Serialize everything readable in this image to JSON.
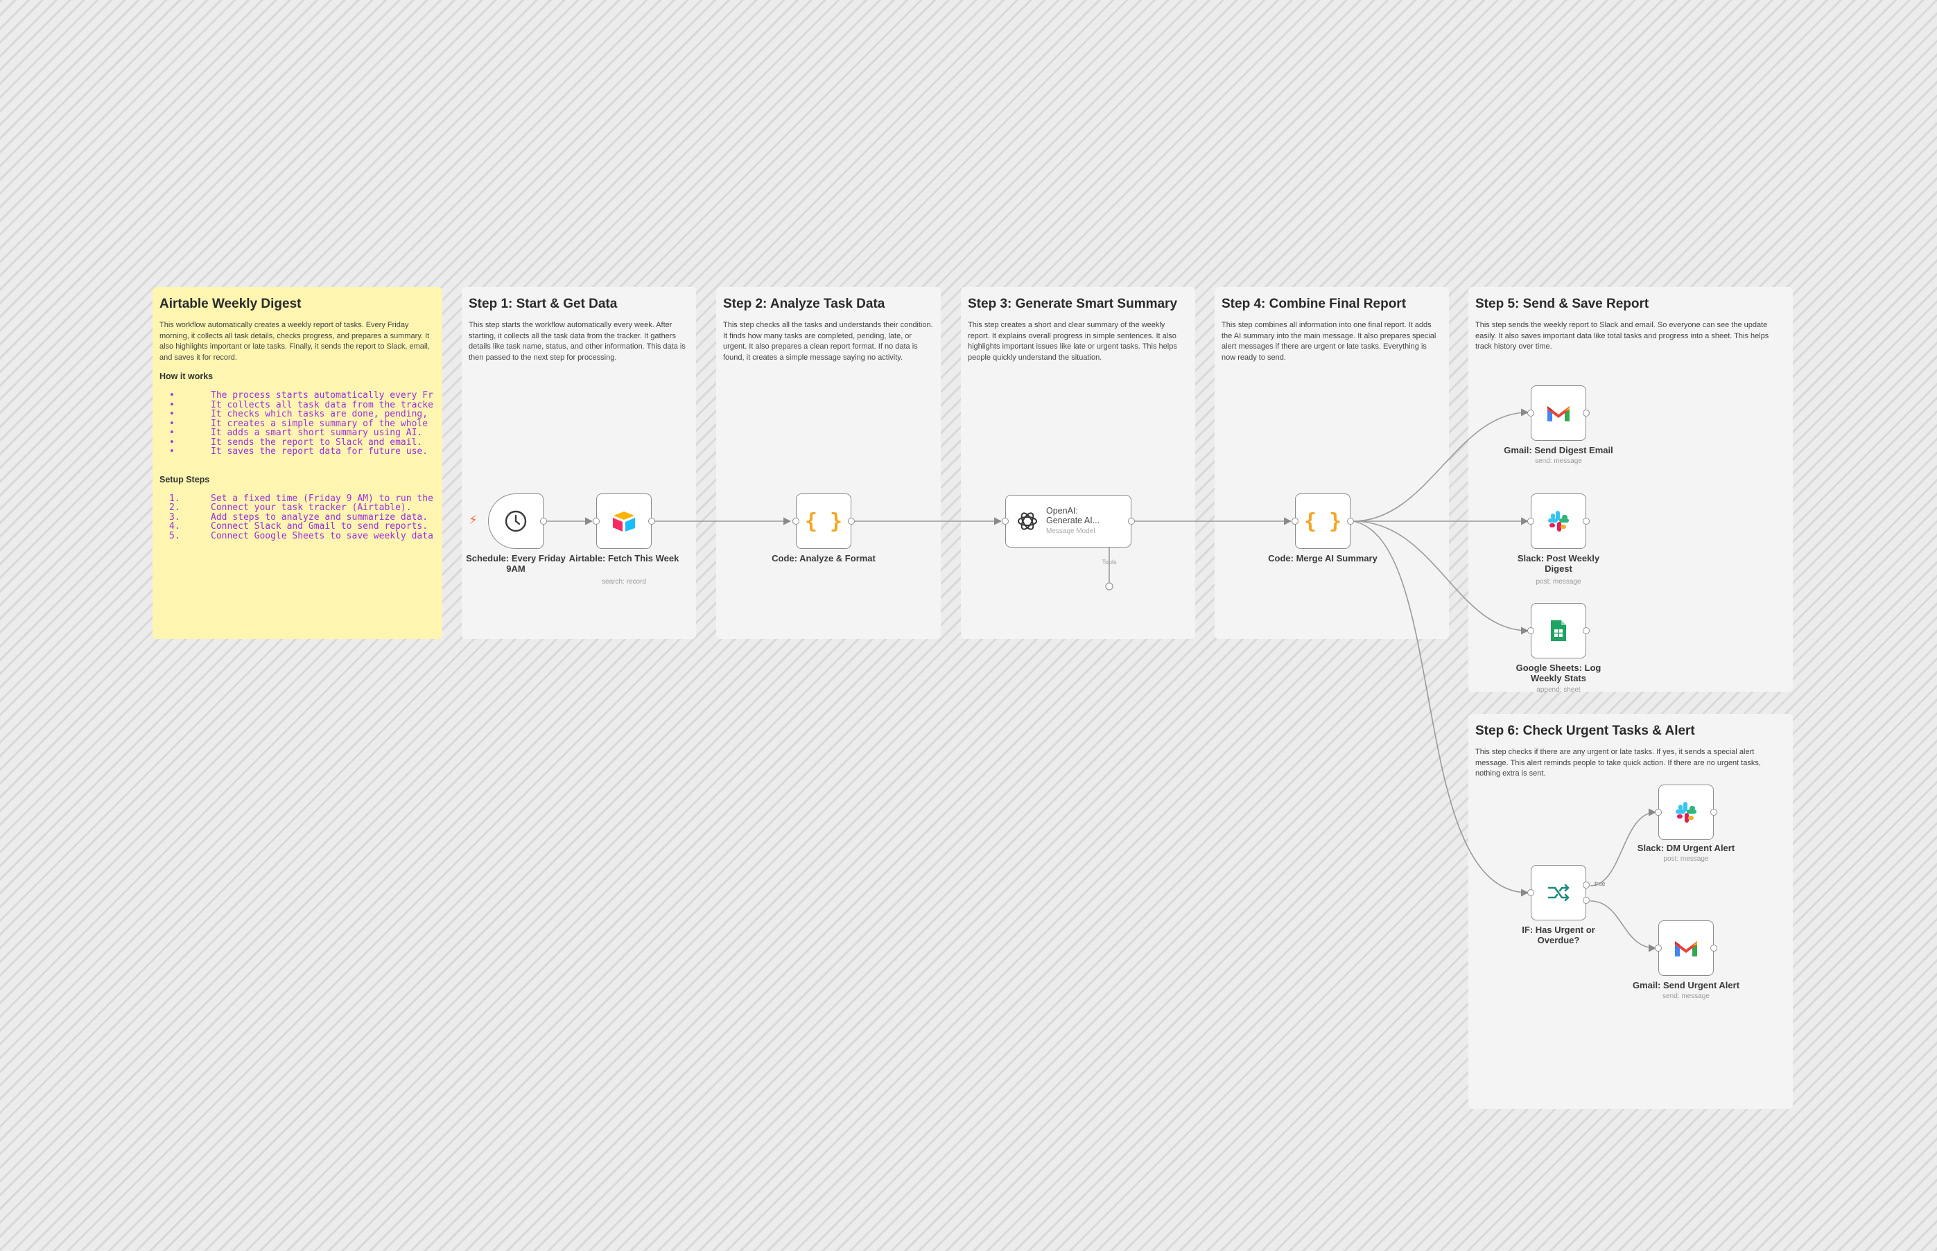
{
  "stickies": {
    "main": {
      "title": "Airtable Weekly Digest",
      "desc": "This workflow automatically creates a weekly report of tasks. Every Friday morning, it collects all task details, checks progress, and prepares a summary. It also highlights important or late tasks. Finally, it sends the report to Slack, email, and saves it for record.",
      "how_title": "How it works",
      "how_items": [
        "The process starts automatically every Fr",
        "It collects all task data from the tracke",
        "It checks which tasks are done, pending, ",
        "It creates a simple summary of the whole ",
        "It adds a smart short summary using AI.",
        "It sends the report to Slack and email.",
        "It saves the report data for future use."
      ],
      "setup_title": "Setup Steps",
      "setup_items": [
        "Set a fixed time (Friday 9 AM) to run the",
        "Connect your task tracker (Airtable).",
        "Add steps to analyze and summarize data.",
        "Connect Slack and Gmail to send reports.",
        "Connect Google Sheets to save weekly data"
      ]
    },
    "step1": {
      "title": "Step 1: Start & Get Data",
      "desc": "This step starts the workflow automatically every week. After starting, it collects all the task data from the tracker. It gathers details like task name, status, and other information. This data is then passed to the next step for processing."
    },
    "step2": {
      "title": "Step 2: Analyze Task Data",
      "desc": "This step checks all the tasks and understands their condition. It finds how many tasks are completed, pending, late, or urgent. It also prepares a clean report format. If no data is found, it creates a simple message saying no activity."
    },
    "step3": {
      "title": "Step 3: Generate Smart Summary",
      "desc": "This step creates a short and clear summary of the weekly report. It explains overall progress in simple sentences. It also highlights important issues like late or urgent tasks. This helps people quickly understand the situation."
    },
    "step4": {
      "title": "Step 4: Combine Final Report",
      "desc": "This step combines all information into one final report. It adds the AI summary into the main message. It also prepares special alert messages if there are urgent or late tasks. Everything is now ready to send."
    },
    "step5": {
      "title": "Step 5: Send & Save Report",
      "desc": "This step sends the weekly report to Slack and email. So everyone can see the update easily. It also saves important data like total tasks and progress into a sheet. This helps track history over time."
    },
    "step6": {
      "title": "Step 6: Check Urgent Tasks & Alert",
      "desc": "This step checks if there are any urgent or late tasks. If yes, it sends a special alert message. This alert reminds people to take quick action. If there are no urgent tasks, nothing extra is sent."
    }
  },
  "nodes": {
    "schedule": {
      "label": "Schedule: Every Friday 9AM",
      "icon": "clock-icon"
    },
    "airtable": {
      "label": "Airtable: Fetch This Week",
      "sub": "search: record",
      "icon": "airtable-icon"
    },
    "code_analyze": {
      "label": "Code: Analyze & Format",
      "icon": "code-braces-icon"
    },
    "openai": {
      "label1": "OpenAI:",
      "label2": "Generate AI...",
      "sub": "Message Model",
      "tools": "Tools",
      "icon": "openai-icon"
    },
    "code_merge": {
      "label": "Code: Merge AI Summary",
      "icon": "code-braces-icon"
    },
    "gmail_digest": {
      "label": "Gmail: Send Digest Email",
      "sub": "send: message",
      "icon": "gmail-icon"
    },
    "slack_post": {
      "label": "Slack: Post Weekly Digest",
      "sub": "post: message",
      "icon": "slack-icon"
    },
    "sheets_log": {
      "label": "Google Sheets: Log Weekly Stats",
      "sub": "append: sheet",
      "icon": "sheets-icon"
    },
    "if_urgent": {
      "label": "IF: Has Urgent or Overdue?",
      "true_label": "true",
      "icon": "if-branch-icon"
    },
    "slack_dm": {
      "label": "Slack: DM Urgent Alert",
      "sub": "post: message",
      "icon": "slack-icon"
    },
    "gmail_urgent": {
      "label": "Gmail: Send Urgent Alert",
      "sub": "send: message",
      "icon": "gmail-icon"
    }
  },
  "colors": {
    "sticky_main": "#fdf5b0",
    "sticky_step": "#f4f4f4",
    "list_text": "#9b2fe0",
    "code_orange": "#f5a623",
    "trigger_bolt": "#ff6d3a",
    "sheets_green": "#1ea362",
    "if_teal": "#1a8a7a"
  }
}
